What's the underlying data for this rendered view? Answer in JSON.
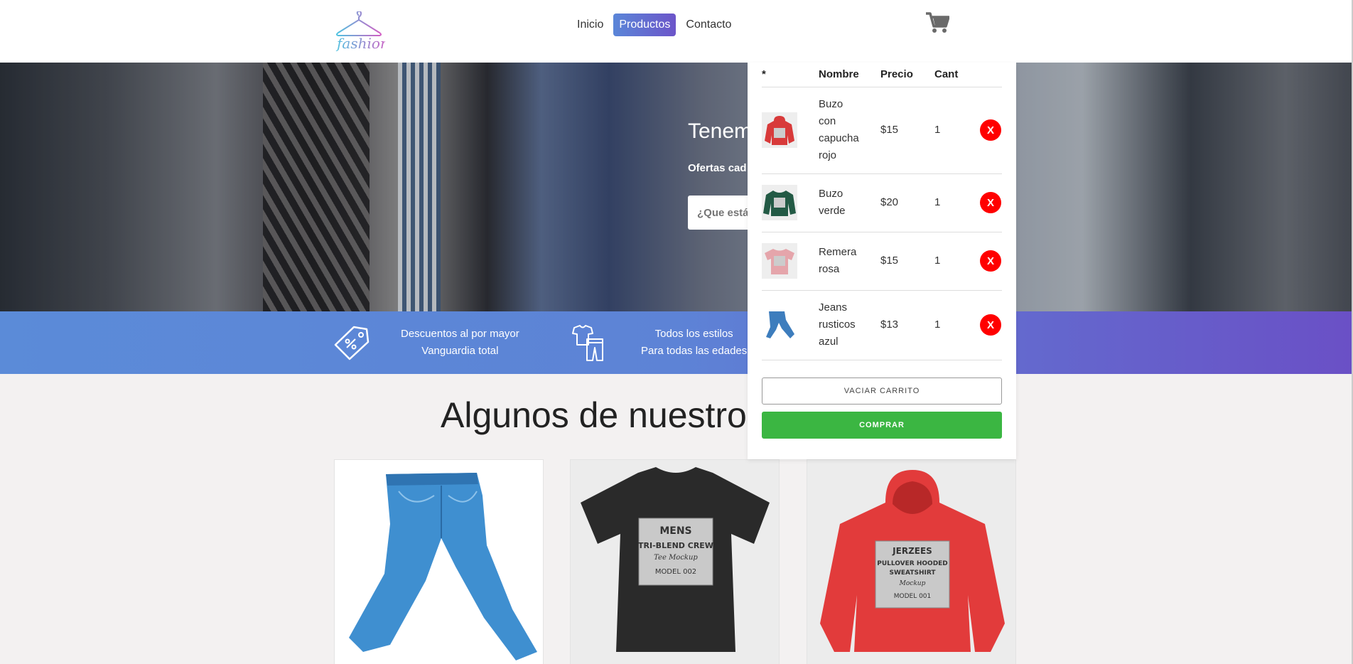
{
  "nav": {
    "items": [
      {
        "label": "Inicio",
        "active": false
      },
      {
        "label": "Productos",
        "active": true
      },
      {
        "label": "Contacto",
        "active": false
      }
    ]
  },
  "logo": {
    "text": "fashion"
  },
  "hero": {
    "title": "Tenem",
    "subtitle": "Ofertas cad",
    "search_placeholder": "¿Que está"
  },
  "features": [
    {
      "icon": "price-tag-icon",
      "line1": "Descuentos al por mayor",
      "line2": "Vanguardia total"
    },
    {
      "icon": "clothes-icon",
      "line1": "Todos los estilos",
      "line2": "Para todas las edades"
    }
  ],
  "section": {
    "title": "Algunos de nuestros"
  },
  "cart": {
    "headers": [
      "*",
      "Nombre",
      "Precio",
      "Cant"
    ],
    "items": [
      {
        "name_lines": [
          "Buzo",
          "con",
          "capucha",
          "rojo"
        ],
        "price": "$15",
        "qty": "1",
        "thumb": "red-hoodie",
        "color": "#d83a3a"
      },
      {
        "name_lines": [
          "Buzo",
          "verde"
        ],
        "price": "$20",
        "qty": "1",
        "thumb": "green-sweatshirt",
        "color": "#235a45"
      },
      {
        "name_lines": [
          "Remera",
          "rosa"
        ],
        "price": "$15",
        "qty": "1",
        "thumb": "pink-tshirt",
        "color": "#e5a5ab"
      },
      {
        "name_lines": [
          "Jeans",
          "rusticos",
          "azul"
        ],
        "price": "$13",
        "qty": "1",
        "thumb": "blue-jeans",
        "color": "#3d7dbd"
      }
    ],
    "delete_label": "X",
    "empty_label": "VACIAR CARRITO",
    "buy_label": "COMPRAR"
  },
  "products": [
    {
      "name": "jeans",
      "color": "#3f8fd0"
    },
    {
      "name": "tshirt",
      "color": "#2a2a2a",
      "print_lines": [
        "MENS",
        "TRI-BLEND CREW",
        "Tee Mockup",
        "MODEL 002"
      ]
    },
    {
      "name": "hoodie",
      "color": "#e23b3b",
      "print_lines": [
        "JERZEES",
        "PULLOVER HOODED",
        "SWEATSHIRT",
        "Mockup",
        "MODEL 001"
      ]
    }
  ],
  "colors": {
    "accent_start": "#5a86d8",
    "accent_end": "#6c55c9",
    "buy": "#3bb642",
    "delete": "#ff0000"
  }
}
